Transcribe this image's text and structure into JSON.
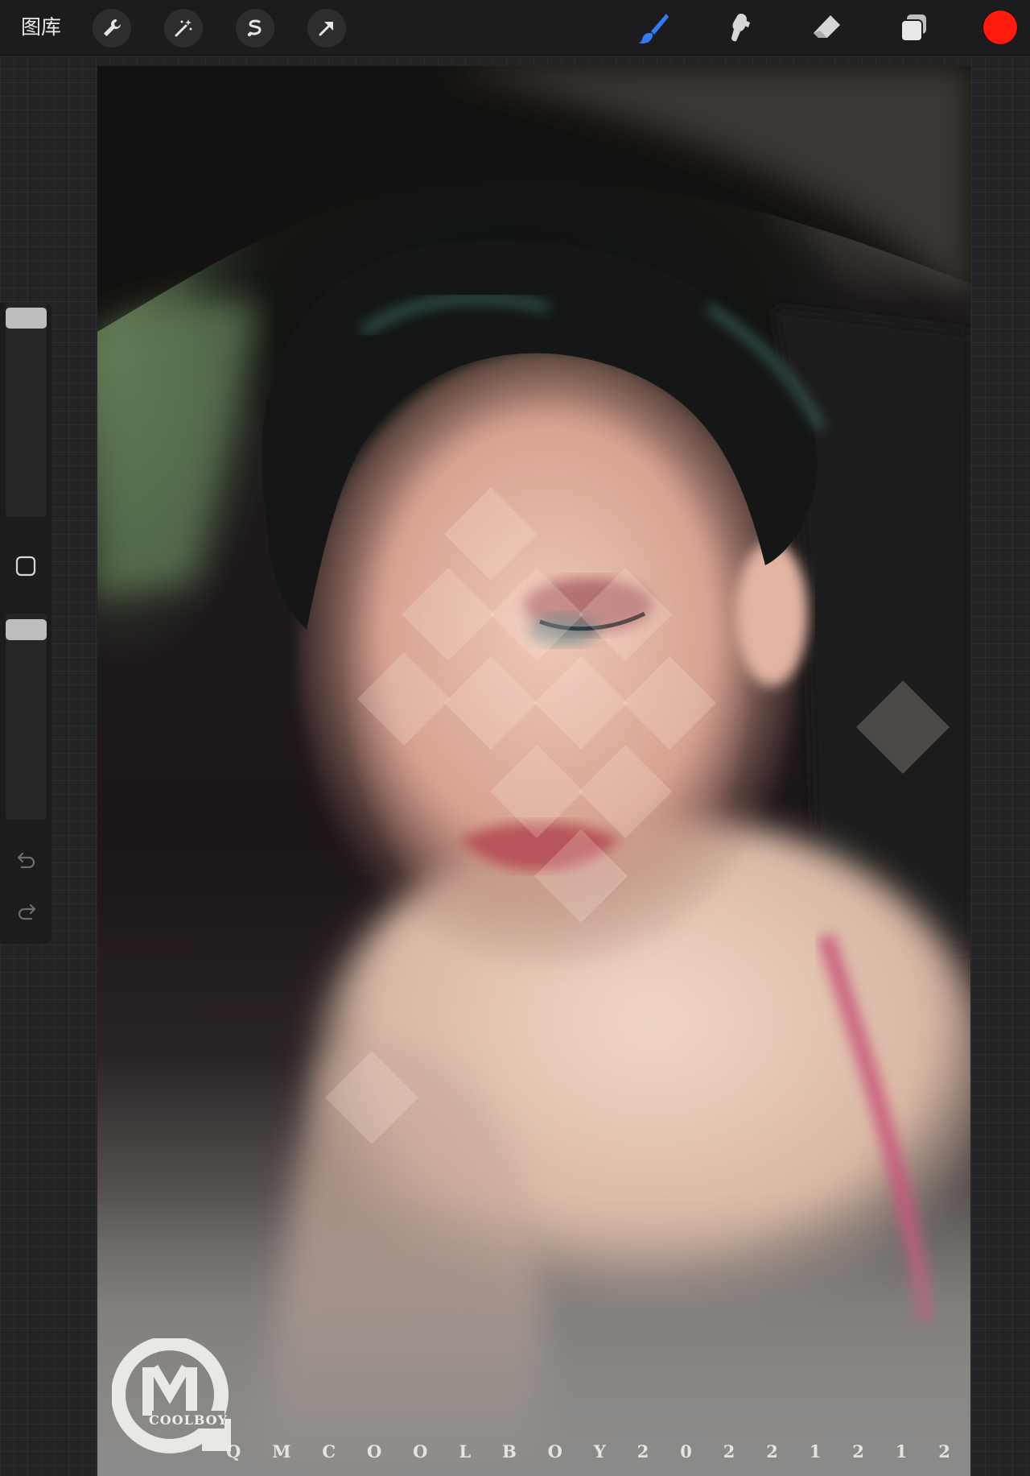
{
  "toolbar": {
    "gallery_label": "图库",
    "left_tools": [
      "wrench-icon",
      "magic-wand-icon",
      "selection-icon",
      "transform-arrow-icon"
    ],
    "right_tools": [
      "brush-icon",
      "smudge-icon",
      "eraser-icon",
      "layers-icon"
    ],
    "active_tool": "brush",
    "active_color": "#ff1a0d",
    "accent": "#2f7cf6"
  },
  "sidebar": {
    "brush_size_level": 1.0,
    "opacity_level": 1.0,
    "icons": [
      "modify-square-icon",
      "undo-icon",
      "redo-icon"
    ]
  },
  "canvas": {
    "watermark_logo_text": "COOLBOY",
    "signature_chars": [
      "Q",
      "M",
      "C",
      "O",
      "O",
      "L",
      "B",
      "O",
      "Y",
      "2",
      "0",
      "2",
      "2",
      "1",
      "2",
      "1",
      "2"
    ]
  }
}
